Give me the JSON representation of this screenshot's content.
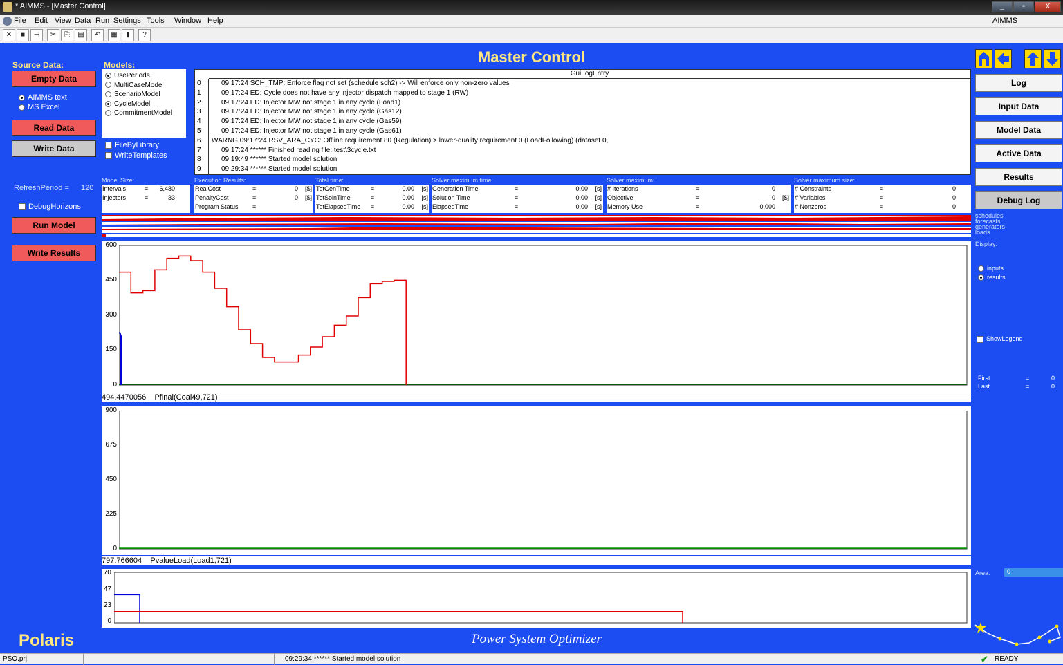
{
  "window": {
    "title": "* AIMMS - [Master Control]",
    "minimize": "_",
    "restore": "▫",
    "close": "X"
  },
  "menu": [
    "File",
    "Edit",
    "View",
    "Data",
    "Run",
    "Settings",
    "Tools",
    "Window",
    "Help"
  ],
  "menu_right": "AIMMS",
  "header": {
    "title": "Master Control",
    "app_name": "Polaris",
    "subtitle": "Power System Optimizer"
  },
  "source": {
    "label": "Source Data:",
    "empty_btn": "Empty Data",
    "opt1": "AIMMS text",
    "opt2": "MS Excel",
    "read_btn": "Read Data",
    "write_btn": "Write Data",
    "refresh_label": "RefreshPeriod =",
    "refresh_value": "120",
    "debug_label": "DebugHorizons",
    "run_btn": "Run Model",
    "write_results_btn": "Write Results"
  },
  "models": {
    "label": "Models:",
    "items": [
      "UsePeriods",
      "MultiCaseModel",
      "ScenarioModel",
      "CycleModel",
      "CommitmentModel"
    ],
    "checks": [
      "FileByLibrary",
      "WriteTemplates"
    ]
  },
  "log": {
    "header": "GuiLogEntry",
    "rows": [
      {
        "n": "0",
        "t": "09:17:24 SCH_TMP: Enforce flag not set (schedule sch2) -> Will enforce only non-zero values"
      },
      {
        "n": "1",
        "t": "09:17:24 ED: Cycle does not have any injector dispatch mapped to stage 1 (RW)"
      },
      {
        "n": "2",
        "t": "09:17:24 ED: Injector MW not stage 1 in any cycle (Load1)"
      },
      {
        "n": "3",
        "t": "09:17:24 ED: Injector MW not stage 1 in any cycle (Gas12)"
      },
      {
        "n": "4",
        "t": "09:17:24 ED: Injector MW not stage 1 in any cycle (Gas59)"
      },
      {
        "n": "5",
        "t": "09:17:24 ED: Injector MW not stage 1 in any cycle (Gas61)"
      },
      {
        "n": "6",
        "t": "WARNG 09:17:24 RSV_ARA_CYC: Offline requirement 80 (Regulation) > lower-quality requirement 0 (LoadFollowing) (dataset 0,"
      },
      {
        "n": "7",
        "t": "09:17:24 ****** Finished reading file: test\\3cycle.txt"
      },
      {
        "n": "8",
        "t": "09:19:49 ****** Started model solution"
      },
      {
        "n": "9",
        "t": "09:29:34 ****** Started model solution"
      }
    ]
  },
  "stats": {
    "model_size": {
      "label": "Model Size:",
      "rows": [
        {
          "k": "Intervals",
          "v": "6,480",
          "u": ""
        },
        {
          "k": "Injectors",
          "v": "33",
          "u": ""
        }
      ]
    },
    "exec": {
      "label": "Execution Results:",
      "rows": [
        {
          "k": "RealCost",
          "v": "0",
          "u": "[$]"
        },
        {
          "k": "PenaltyCost",
          "v": "0",
          "u": "[$]"
        },
        {
          "k": "Program Status",
          "v": "",
          "u": ""
        }
      ]
    },
    "total": {
      "label": "Total time:",
      "rows": [
        {
          "k": "TotGenTime",
          "v": "0.00",
          "u": "[s]"
        },
        {
          "k": "TotSolnTime",
          "v": "0.00",
          "u": "[s]"
        },
        {
          "k": "TotElapsedTime",
          "v": "0.00",
          "u": "[s]"
        }
      ]
    },
    "solver_time": {
      "label": "Solver maximum time:",
      "rows": [
        {
          "k": "Generation Time",
          "v": "0.00",
          "u": "[s]"
        },
        {
          "k": "Solution Time",
          "v": "0.00",
          "u": "[s]"
        },
        {
          "k": "ElapsedTime",
          "v": "0.00",
          "u": "[s]"
        }
      ]
    },
    "solver_max": {
      "label": "Solver maximum:",
      "rows": [
        {
          "k": "# Iterations",
          "v": "0",
          "u": ""
        },
        {
          "k": "Objective",
          "v": "0",
          "u": "[$]"
        },
        {
          "k": "Memory Use",
          "v": "0.000",
          "u": ""
        }
      ]
    },
    "solver_size": {
      "label": "Solver maximum size:",
      "rows": [
        {
          "k": "# Constraints",
          "v": "0",
          "u": ""
        },
        {
          "k": "# Variables",
          "v": "0",
          "u": ""
        },
        {
          "k": "# Nonzeros",
          "v": "0",
          "u": ""
        }
      ]
    }
  },
  "right": {
    "buttons": [
      "Log",
      "Input Data",
      "Model Data",
      "Active Data",
      "Results",
      "Debug Log"
    ],
    "legend": [
      "schedules",
      "forecasts",
      "generators",
      "loads"
    ],
    "display_label": "Display:",
    "display_opts": [
      "inputs",
      "results"
    ],
    "show_legend": "ShowLegend",
    "first_label": "First",
    "last_label": "Last",
    "eq": "=",
    "first_value": "0",
    "last_value": "0",
    "area_label": "Area:",
    "area_value": "0"
  },
  "chart_data": [
    {
      "type": "line",
      "title": "",
      "ylim": [
        0,
        600
      ],
      "yticks": [
        "600",
        "450",
        "300",
        "150",
        "0"
      ],
      "caption_value": "494.4470056",
      "caption_name": "Pfinal(Coal49,721)",
      "series": [
        {
          "color": "#e00000",
          "step_values": [
            490,
            400,
            410,
            500,
            550,
            560,
            540,
            490,
            420,
            340,
            240,
            180,
            120,
            100,
            100,
            130,
            165,
            210,
            260,
            300,
            380,
            440,
            450,
            455
          ]
        },
        {
          "color": "#0000dd",
          "step_values": [
            230
          ]
        }
      ]
    },
    {
      "type": "line",
      "ylim": [
        0,
        900
      ],
      "yticks": [
        "900",
        "675",
        "450",
        "225",
        "0"
      ],
      "caption_value": "797.766604",
      "caption_name": "PvalueLoad(Load1,721)",
      "series": [
        {
          "color": "#00a000",
          "values": [
            0
          ]
        }
      ]
    },
    {
      "type": "line",
      "ylim": [
        0,
        70
      ],
      "yticks": [
        "70",
        "47",
        "23",
        "0"
      ],
      "series": [
        {
          "color": "#0000dd",
          "value": 40
        },
        {
          "color": "#e00000",
          "value": 16
        }
      ]
    }
  ],
  "status": {
    "file": "PSO.prj",
    "message": "09:29:34 ****** Started model solution",
    "ready": "READY"
  }
}
